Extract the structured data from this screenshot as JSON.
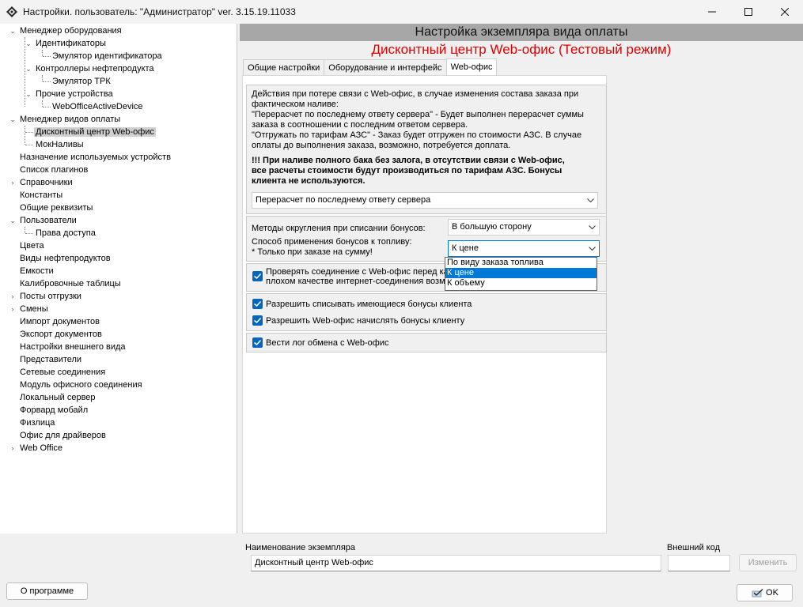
{
  "window": {
    "title": "Настройки. пользователь: \"Администратор\" ver. 3.15.19.11033",
    "minimize_glyph": "—",
    "maximize_glyph": "☐",
    "close_glyph": "✕"
  },
  "tree": {
    "items": [
      {
        "label": "Менеджер оборудования"
      },
      {
        "label": "Идентификаторы"
      },
      {
        "label": "Эмулятор идентификатора"
      },
      {
        "label": "Контроллеры нефтепродукта"
      },
      {
        "label": "Эмулятор ТРК"
      },
      {
        "label": "Прочие устройства"
      },
      {
        "label": "WebOfficeActiveDevice"
      },
      {
        "label": "Менеджер видов оплаты"
      },
      {
        "label": "Дисконтный центр Web-офис"
      },
      {
        "label": "МокНаливы"
      },
      {
        "label": "Назначение используемых устройств"
      },
      {
        "label": "Список плагинов"
      },
      {
        "label": "Справочники"
      },
      {
        "label": "Константы"
      },
      {
        "label": "Общие реквизиты"
      },
      {
        "label": "Пользователи"
      },
      {
        "label": "Права доступа"
      },
      {
        "label": "Цвета"
      },
      {
        "label": "Виды нефтепродуктов"
      },
      {
        "label": "Емкости"
      },
      {
        "label": "Калибровочные таблицы"
      },
      {
        "label": "Посты отгрузки"
      },
      {
        "label": "Смены"
      },
      {
        "label": "Импорт документов"
      },
      {
        "label": "Экспорт документов"
      },
      {
        "label": "Настройки внешнего вида"
      },
      {
        "label": "Представители"
      },
      {
        "label": "Сетевые соединения"
      },
      {
        "label": "Модуль офисного соединения"
      },
      {
        "label": "Локальный сервер"
      },
      {
        "label": "Форвард мобайл"
      },
      {
        "label": "Физлица"
      },
      {
        "label": "Офис для драйверов"
      },
      {
        "label": "Web Office"
      }
    ]
  },
  "panel": {
    "header": "Настройка экземпляра вида оплаты",
    "subtitle": "Дисконтный центр Web-офис (Тестовый режим)",
    "tabs": [
      {
        "label": "Общие настройки"
      },
      {
        "label": "Оборудование и интерфейс"
      },
      {
        "label": "Web-офис"
      }
    ]
  },
  "webtab": {
    "desc_lines": [
      "Действия при потере связи с Web-офис, в случае изменения состава заказа при",
      "фактическом наливе:",
      "\"Перерасчет по последнему ответу сервера\" - Будет выполнен перерасчет суммы",
      "заказа в соотношении с последним ответом сервера.",
      "\"Отгружать по тарифам АЗС\" - Заказ будет отгружен по стоимости АЗС. В случае",
      "оплаты до выполнения заказа, возможно, потребуется доплата."
    ],
    "warning_lines": [
      "!!! При наливе полного бака без залога, в отсутствии связи с Web-офис,",
      "все расчеты стоимости будут производиться по тарифам АЗС. Бонусы",
      "клиента не используются."
    ],
    "loss_action_value": "Перерасчет по последнему ответу сервера",
    "rounding_label": "Методы округления при списании бонусов:",
    "rounding_value": "В большую сторону",
    "bonus_method_label": "Способ применения бонусов к топливу:",
    "bonus_method_note": "* Только при заказе на сумму!",
    "bonus_method_value": "К цене",
    "bonus_method_options": [
      "По виду заказа топлива",
      "К цене",
      "К объему"
    ],
    "check_connection_line1": "Проверять соединение с Web-офис перед ка",
    "check_connection_line2": "плохом качестве интернет-соединения возмо",
    "allow_writeoff": "Разрешить списывать имеющиеся бонусы клиента",
    "allow_accrual": "Разрешить Web-офис начислять бонусы клиенту",
    "log_exchange": "Вести лог обмена с Web-офис"
  },
  "instance": {
    "name_label": "Наименование экземпляра",
    "name_value": "Дисконтный центр Web-офис",
    "code_label": "Внешний код",
    "code_value": "",
    "change_button": "Изменить"
  },
  "footer": {
    "about_button": "О программе",
    "ok_button": "OK"
  }
}
